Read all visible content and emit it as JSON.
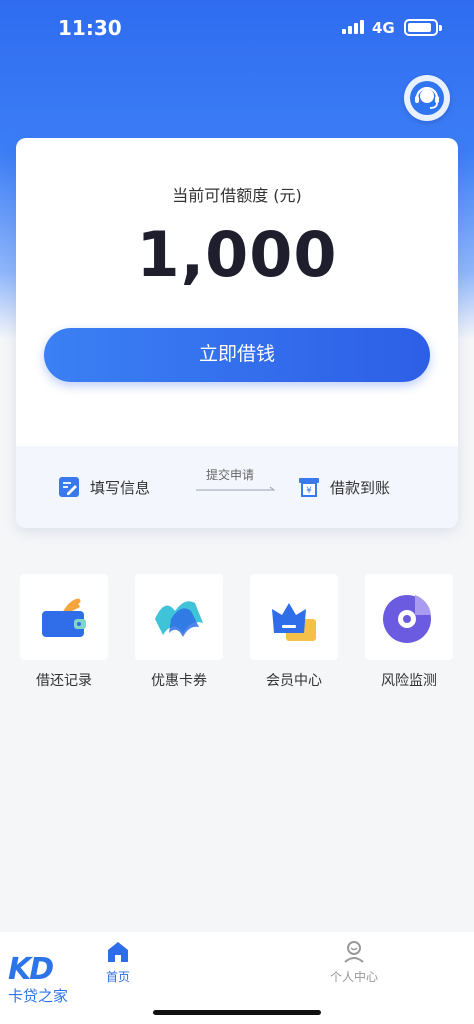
{
  "status_bar": {
    "time": "11:30",
    "network": "4G"
  },
  "card": {
    "quota_label": "当前可借额度 (元)",
    "quota_value": "1,000",
    "borrow_button": "立即借钱",
    "steps": {
      "step1": "填写信息",
      "submit": "提交申请",
      "step2": "借款到账"
    }
  },
  "shortcuts": [
    {
      "label": "借还记录",
      "icon": "wallet-icon"
    },
    {
      "label": "优惠卡券",
      "icon": "coupon-icon"
    },
    {
      "label": "会员中心",
      "icon": "crown-icon"
    },
    {
      "label": "风险监测",
      "icon": "radar-icon"
    }
  ],
  "tabbar": {
    "logo_mark": "KD",
    "logo_text": "卡贷之家",
    "home": "首页",
    "me": "个人中心"
  },
  "colors": {
    "brand_blue": "#2d6ee8",
    "accent_orange": "#f5a53b",
    "purple": "#6a5be0"
  }
}
